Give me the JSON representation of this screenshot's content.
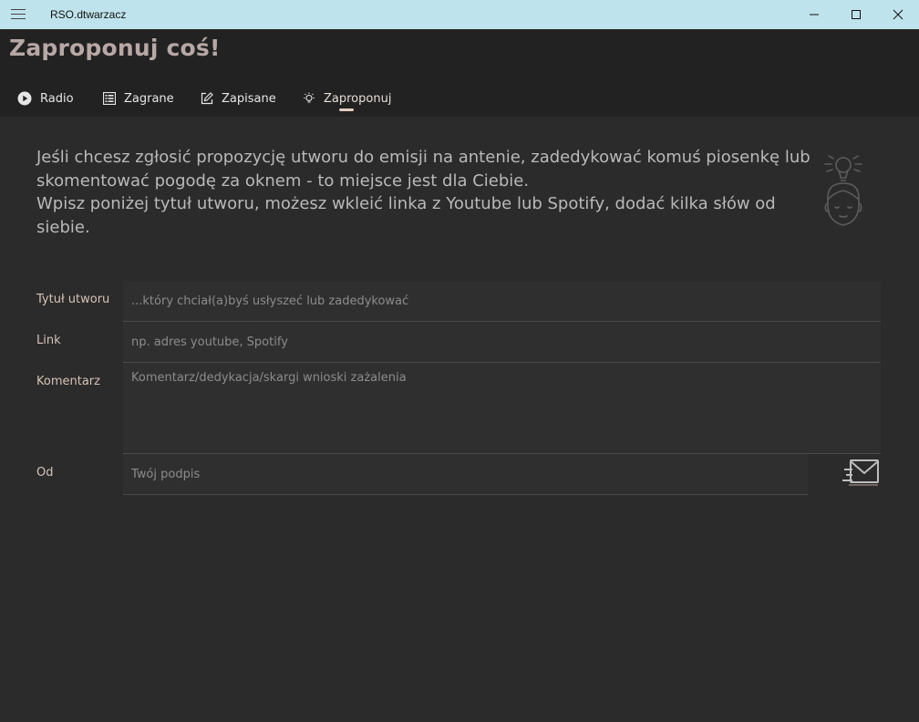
{
  "window": {
    "app_title": "RSO.dtwarzacz"
  },
  "header": {
    "title": "Zaproponuj coś!"
  },
  "nav": {
    "items": [
      {
        "label": "Radio",
        "icon": "play-circle-icon"
      },
      {
        "label": "Zagrane",
        "icon": "list-icon"
      },
      {
        "label": "Zapisane",
        "icon": "edit-icon"
      },
      {
        "label": "Zaproponuj",
        "icon": "lightbulb-icon"
      }
    ],
    "active": "Zaproponuj"
  },
  "intro": {
    "line1": "Jeśli chcesz zgłosić propozycję utworu do emisji na antenie, zadedykować komuś piosenkę lub skomentować pogodę za oknem - to miejsce jest dla Ciebie.",
    "line2": "Wpisz poniżej tytuł utworu, możesz wkleić linka z Youtube lub Spotify, dodać kilka słów od siebie."
  },
  "form": {
    "title": {
      "label": "Tytuł utworu",
      "value": "",
      "placeholder": "...który chciał(a)byś usłyszeć lub zadedykować"
    },
    "link": {
      "label": "Link",
      "value": "",
      "placeholder": "np. adres youtube, Spotify"
    },
    "comment": {
      "label": "Komentarz",
      "value": "",
      "placeholder": "Komentarz/dedykacja/skargi wnioski zażalenia"
    },
    "from": {
      "label": "Od",
      "value": "",
      "placeholder": "Twój podpis"
    },
    "send_icon": "send-mail-icon"
  },
  "colors": {
    "titlebar": "#bfe3ec",
    "header_bg": "#222222",
    "content_bg": "#2b2b2b",
    "accent": "#e2cdbf",
    "title_color": "#b8a8a5"
  }
}
